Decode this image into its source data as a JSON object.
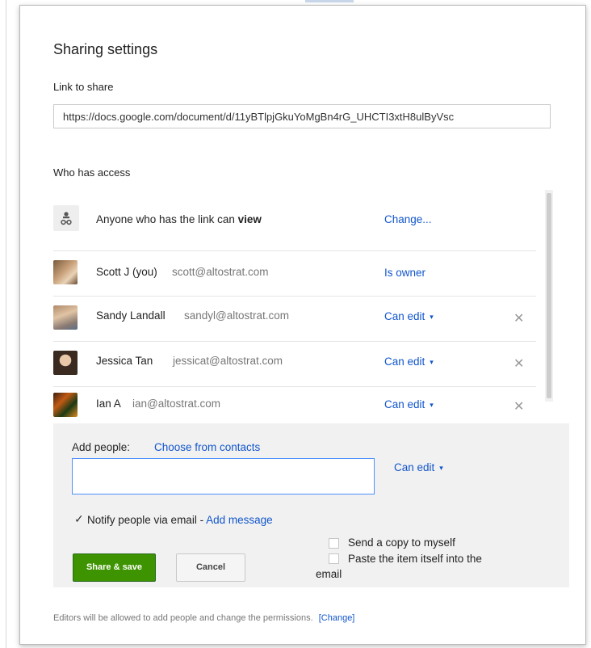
{
  "dialog": {
    "title": "Sharing settings",
    "link_label": "Link to share",
    "link_url": "https://docs.google.com/document/d/11yBTlpjGkuYoMgBn4rG_UHCTI3xtH8ulByVsc",
    "who_label": "Who has access"
  },
  "access": {
    "anyone": {
      "prefix": "Anyone who has the link can ",
      "level": "view",
      "action": "Change..."
    },
    "people": [
      {
        "name": "Scott J (you)",
        "email": "scott@altostrat.com",
        "permission": "Is owner"
      },
      {
        "name": "Sandy Landall",
        "email": "sandyl@altostrat.com",
        "permission": "Can edit"
      },
      {
        "name": "Jessica Tan",
        "email": "jessicat@altostrat.com",
        "permission": "Can edit"
      },
      {
        "name": "Ian A",
        "email": "ian@altostrat.com",
        "permission": "Can edit"
      }
    ],
    "remove_glyph": "✕",
    "caret": "▾"
  },
  "add_people": {
    "label": "Add people:",
    "choose_link": "Choose from contacts",
    "permission": "Can edit",
    "notify_label": "Notify people via email - ",
    "notify_checked": true,
    "add_message": "Add message",
    "copy_label": "Send a copy to myself",
    "paste_label_line1": "Paste the item itself into the",
    "paste_label_line2": "email",
    "share_button": "Share & save",
    "cancel_button": "Cancel"
  },
  "footer": {
    "note": "Editors will be allowed to add people and change the permissions.",
    "change_link": "[Change]"
  },
  "colors": {
    "link_blue": "#1155cc",
    "share_green": "#3d9400",
    "panel_gray": "#f1f1f1"
  }
}
